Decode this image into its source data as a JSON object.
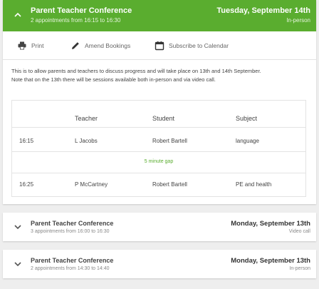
{
  "colors": {
    "accent": "#5aad2f",
    "background": "#eeeeee"
  },
  "expanded_card": {
    "title": "Parent Teacher Conference",
    "subtitle": "2 appointments from 16:15 to 16:30",
    "date": "Tuesday, September 14th",
    "mode": "In-person",
    "toolbar": {
      "print_label": "Print",
      "amend_label": "Amend Bookings",
      "subscribe_label": "Subscribe to Calendar"
    },
    "description_line1": "This is to allow parents and teachers to discuss progress and will take place on 13th and 14th September.",
    "description_line2": "Note that on the 13th there will be sessions available both in-person and via video call.",
    "table": {
      "headers": {
        "teacher": "Teacher",
        "student": "Student",
        "subject": "Subject"
      },
      "rows": [
        {
          "time": "16:15",
          "teacher": "L Jacobs",
          "student": "Robert Bartell",
          "subject": "language"
        },
        {
          "time": "16:25",
          "teacher": "P McCartney",
          "student": "Robert Bartell",
          "subject": "PE and health"
        }
      ],
      "gap_label": "5 minute gap"
    }
  },
  "collapsed_cards": [
    {
      "title": "Parent Teacher Conference",
      "subtitle": "3 appointments from 16:00 to 16:30",
      "date": "Monday, September 13th",
      "mode": "Video call"
    },
    {
      "title": "Parent Teacher Conference",
      "subtitle": "2 appointments from 14:30 to 14:40",
      "date": "Monday, September 13th",
      "mode": "In-person"
    }
  ]
}
